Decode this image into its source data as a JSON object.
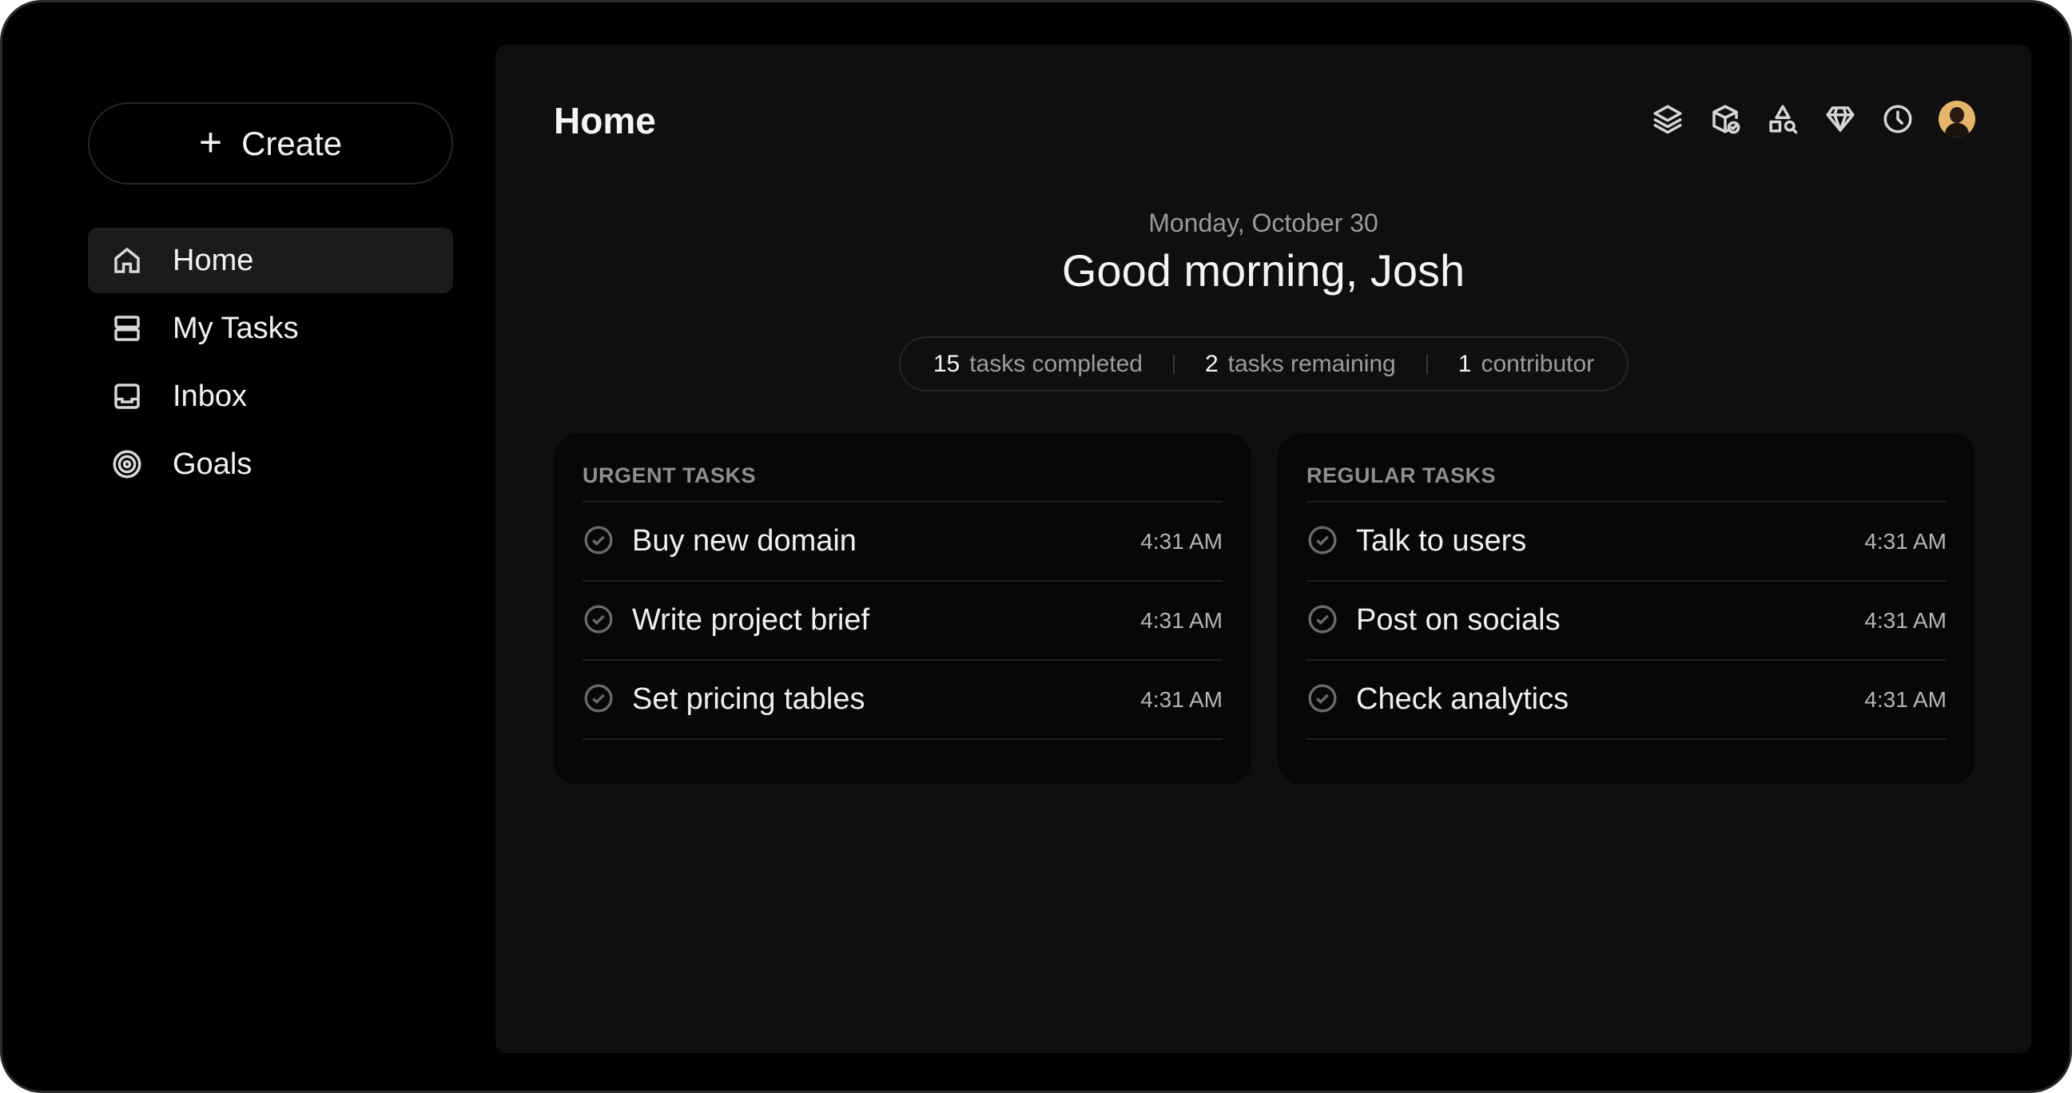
{
  "sidebar": {
    "create_label": "Create",
    "items": [
      {
        "label": "Home",
        "icon": "home-icon",
        "active": true
      },
      {
        "label": "My Tasks",
        "icon": "tasks-icon",
        "active": false
      },
      {
        "label": "Inbox",
        "icon": "inbox-icon",
        "active": false
      },
      {
        "label": "Goals",
        "icon": "target-icon",
        "active": false
      }
    ]
  },
  "header": {
    "title": "Home",
    "toolbar_icons": [
      "layers-icon",
      "package-check-icon",
      "shapes-search-icon",
      "gem-icon",
      "clock-icon",
      "avatar"
    ]
  },
  "greeting": {
    "date": "Monday, October 30",
    "message": "Good morning, Josh"
  },
  "stats": [
    {
      "value": "15",
      "label": "tasks completed"
    },
    {
      "value": "2",
      "label": "tasks remaining"
    },
    {
      "value": "1",
      "label": "contributor"
    }
  ],
  "urgent": {
    "title": "URGENT TASKS",
    "tasks": [
      {
        "name": "Buy new domain",
        "time": "4:31 AM"
      },
      {
        "name": "Write project brief",
        "time": "4:31 AM"
      },
      {
        "name": "Set pricing tables",
        "time": "4:31 AM"
      }
    ]
  },
  "regular": {
    "title": "REGULAR TASKS",
    "tasks": [
      {
        "name": "Talk to users",
        "time": "4:31 AM"
      },
      {
        "name": "Post on socials",
        "time": "4:31 AM"
      },
      {
        "name": "Check analytics",
        "time": "4:31 AM"
      }
    ]
  },
  "colors": {
    "background": "#000000",
    "panel": "#0f0f0f",
    "card": "#070707",
    "active_nav": "#1b1b1b",
    "text": "#f4f4f4",
    "muted": "#9a9a9a"
  }
}
